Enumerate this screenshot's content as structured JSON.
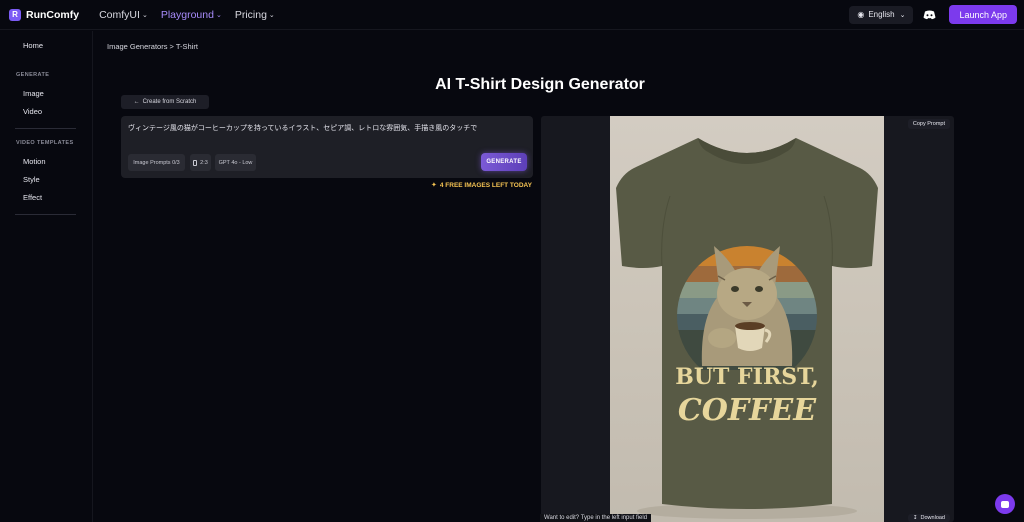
{
  "app": {
    "name": "RunComfy",
    "logo_letter": "R"
  },
  "nav": {
    "items": [
      {
        "label": "ComfyUI",
        "active": false
      },
      {
        "label": "Playground",
        "active": true
      },
      {
        "label": "Pricing",
        "active": false
      }
    ],
    "language": "English",
    "launch_label": "Launch App",
    "accent_color": "#7c3aed"
  },
  "sidebar": {
    "home": "Home",
    "generate_heading": "GENERATE",
    "generate_items": [
      "Image",
      "Video"
    ],
    "templates_heading": "VIDEO TEMPLATES",
    "template_items": [
      "Motion",
      "Style",
      "Effect"
    ]
  },
  "breadcrumb": {
    "parent": "Image Generators",
    "separator": ">",
    "current": "T-Shirt"
  },
  "page": {
    "title": "AI T-Shirt Design Generator"
  },
  "editor": {
    "scratch_label": "Create from Scratch",
    "prompt_text": "ヴィンテージ風の猫がコーヒーカップを持っているイラスト、セピア調、レトロな雰囲気、手描き風のタッチで",
    "chips": {
      "image_prompts": "Image Prompts 0/3",
      "ratio": "2:3",
      "model": "GPT 4o - Low"
    },
    "generate_label": "GENERATE",
    "free_note": "4 FREE IMAGES LEFT TODAY"
  },
  "preview": {
    "copy_prompt_label": "Copy Prompt",
    "shirt_text_line1": "BUT FIRST,",
    "shirt_text_line2": "COFFEE",
    "edit_hint": "Want to edit? Type in the left input field",
    "download_label": "Download"
  }
}
